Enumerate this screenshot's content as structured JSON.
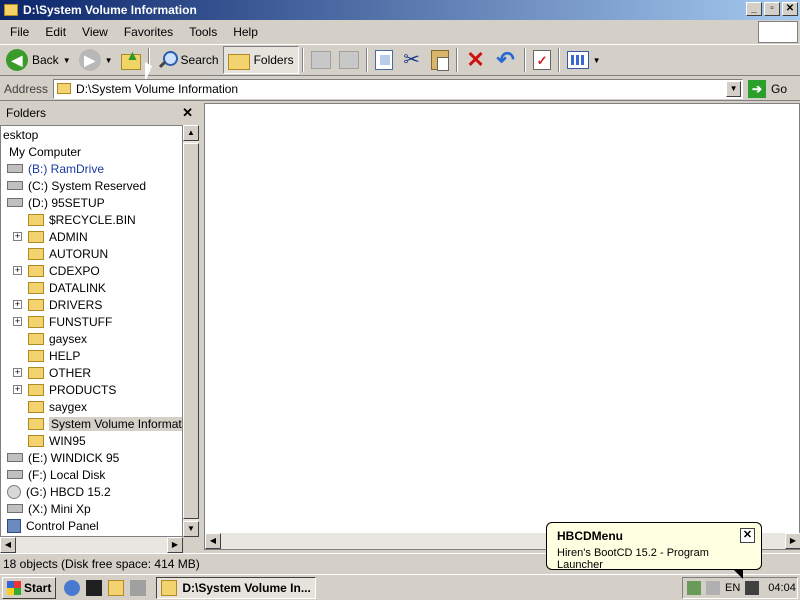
{
  "window": {
    "title": "D:\\System Volume Information",
    "controls": {
      "minimize": "_",
      "maximize": "▫",
      "close": "✕"
    }
  },
  "menu": [
    "File",
    "Edit",
    "View",
    "Favorites",
    "Tools",
    "Help"
  ],
  "toolbar": {
    "back_label": "Back",
    "search_label": "Search",
    "folders_label": "Folders",
    "folders_pressed": true
  },
  "address": {
    "label": "Address",
    "value": "D:\\System Volume Information",
    "go_label": "Go"
  },
  "folders_pane": {
    "title": "Folders",
    "items": [
      {
        "label": "esktop",
        "icon": "none"
      },
      {
        "label": "My Computer",
        "icon": "computer-icon"
      },
      {
        "label": "(B:) RamDrive",
        "icon": "drive-icon"
      },
      {
        "label": "(C:) System Reserved",
        "icon": "drive-icon"
      },
      {
        "label": "(D:) 95SETUP",
        "icon": "drive-icon"
      },
      {
        "label": "$RECYCLE.BIN",
        "icon": "folder-icon"
      },
      {
        "label": "ADMIN",
        "icon": "folder-icon",
        "expander": "+"
      },
      {
        "label": "AUTORUN",
        "icon": "folder-icon"
      },
      {
        "label": "CDEXPO",
        "icon": "folder-icon",
        "expander": "+"
      },
      {
        "label": "DATALINK",
        "icon": "folder-icon"
      },
      {
        "label": "DRIVERS",
        "icon": "folder-icon",
        "expander": "+"
      },
      {
        "label": "FUNSTUFF",
        "icon": "folder-icon",
        "expander": "+"
      },
      {
        "label": "gaysex",
        "icon": "folder-icon"
      },
      {
        "label": "HELP",
        "icon": "folder-icon"
      },
      {
        "label": "OTHER",
        "icon": "folder-icon",
        "expander": "+"
      },
      {
        "label": "PRODUCTS",
        "icon": "folder-icon",
        "expander": "+"
      },
      {
        "label": "saygex",
        "icon": "folder-icon"
      },
      {
        "label": "System Volume Information",
        "icon": "folder-open-icon",
        "selected": true
      },
      {
        "label": "WIN95",
        "icon": "folder-icon"
      },
      {
        "label": "(E:) WINDICK 95",
        "icon": "drive-icon"
      },
      {
        "label": "(F:) Local Disk",
        "icon": "drive-icon"
      },
      {
        "label": "(G:) HBCD 15.2",
        "icon": "cd-icon"
      },
      {
        "label": "(X:) Mini Xp",
        "icon": "drive-icon"
      },
      {
        "label": "Control Panel",
        "icon": "control-panel-icon"
      }
    ]
  },
  "status": {
    "text": "18 objects (Disk free space: 414 MB)"
  },
  "taskbar": {
    "start_label": "Start",
    "task_label": "D:\\System Volume In...",
    "lang": "EN",
    "time": "04:04"
  },
  "balloon": {
    "title": "HBCDMenu",
    "text": "Hiren's BootCD 15.2 - Program Launcher"
  },
  "colors": {
    "titlebar_start": "#0a246a",
    "titlebar_end": "#a6caf0",
    "face": "#d4d0c8",
    "balloon_bg": "#ffffe1"
  }
}
